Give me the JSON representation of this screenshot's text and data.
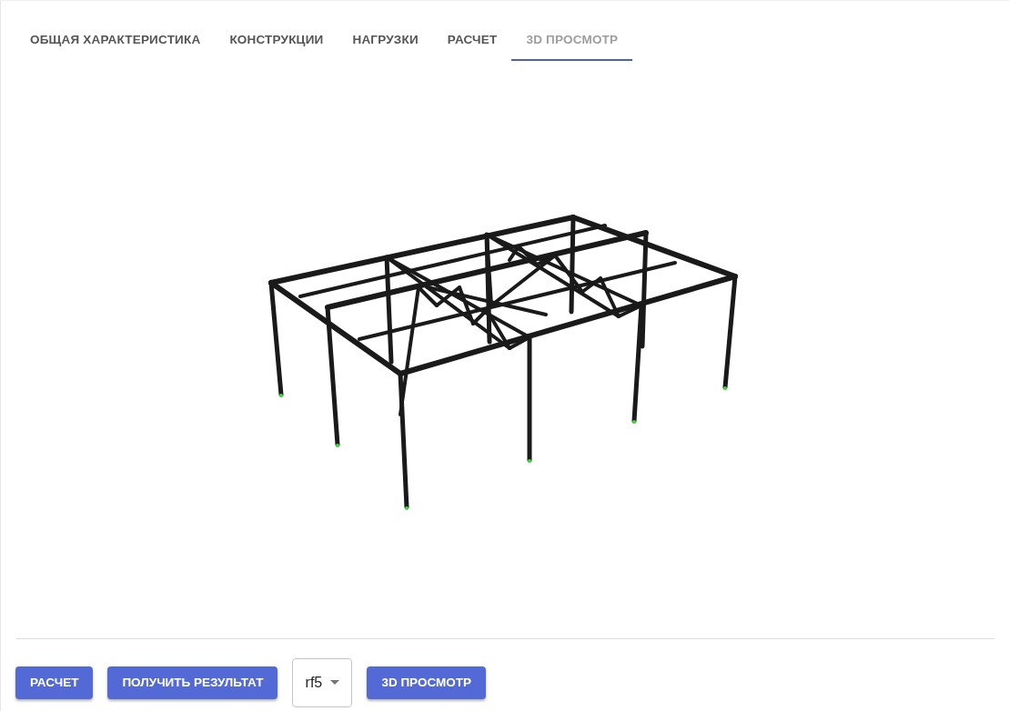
{
  "tabs": [
    {
      "label": "ОБЩАЯ ХАРАКТЕРИСТИКА",
      "selected": false
    },
    {
      "label": "КОНСТРУКЦИИ",
      "selected": false
    },
    {
      "label": "НАГРУЗКИ",
      "selected": false
    },
    {
      "label": "РАСЧЕТ",
      "selected": false
    },
    {
      "label": "3D ПРОСМОТР",
      "selected": true
    }
  ],
  "actions": [
    {
      "kind": "button",
      "label": "РАСЧЕТ"
    },
    {
      "kind": "button",
      "label": "ПОЛУЧИТЬ РЕЗУЛЬТАТ"
    },
    {
      "kind": "select",
      "value": "rf5"
    },
    {
      "kind": "button",
      "label": "3D ПРОСМОТР"
    }
  ]
}
